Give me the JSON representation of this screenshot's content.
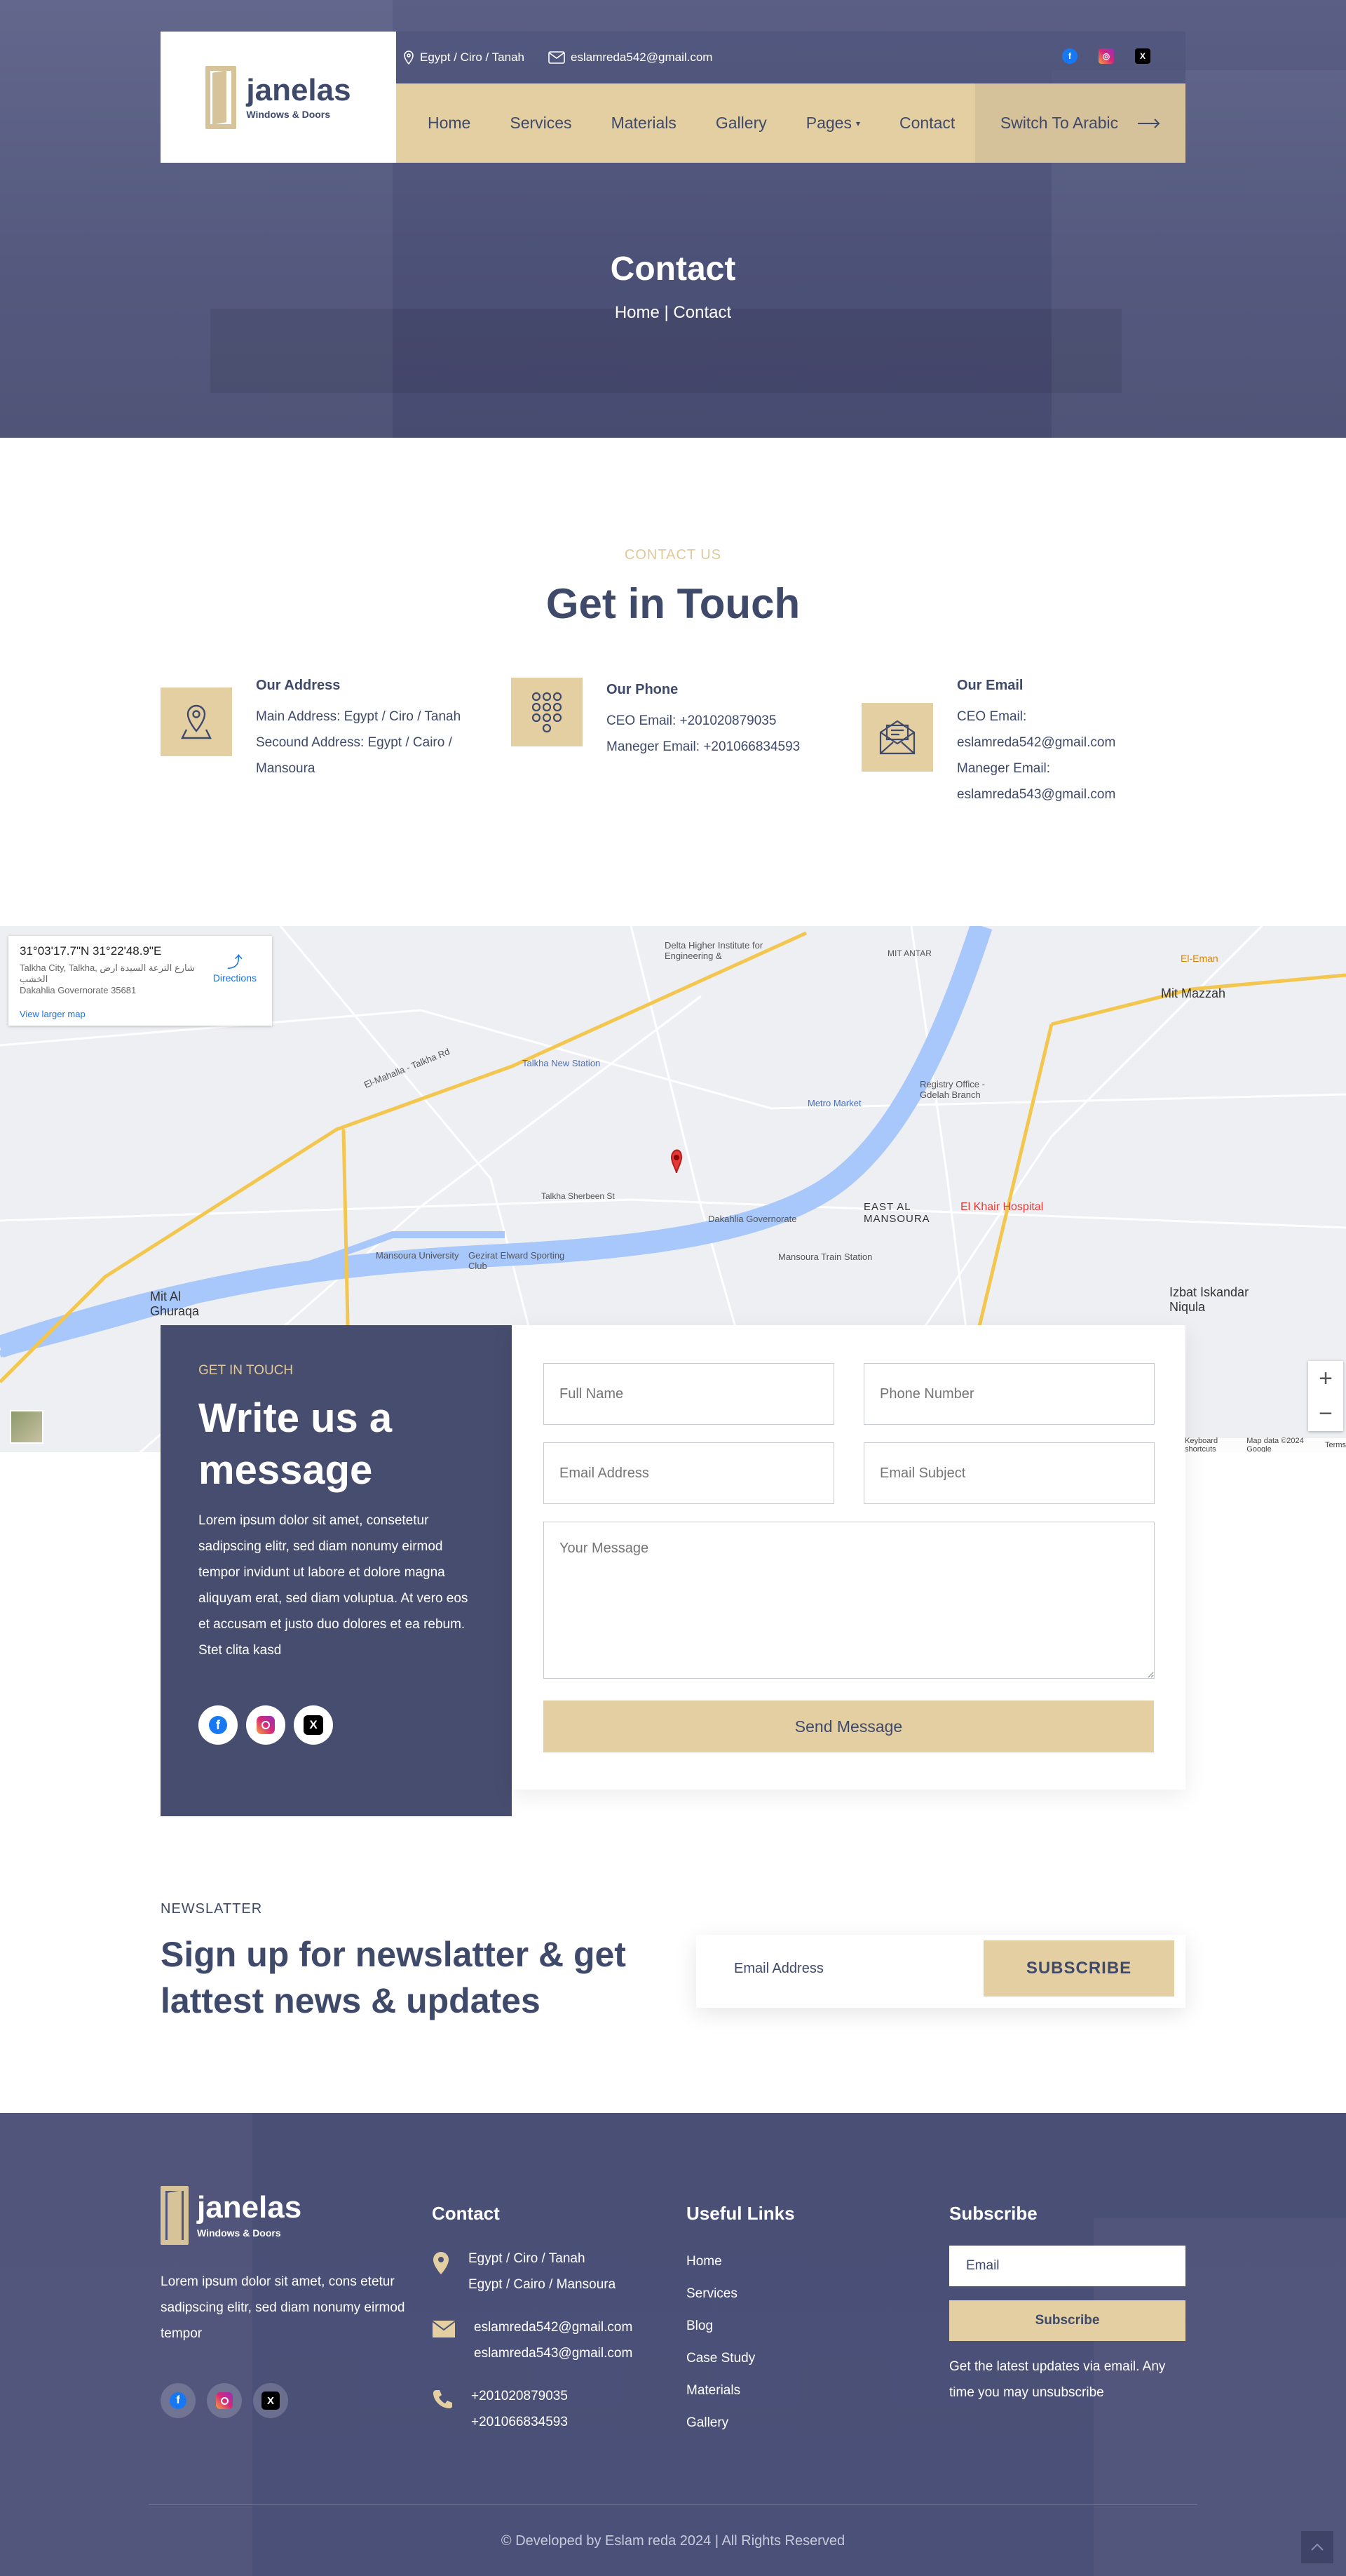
{
  "header": {
    "brand": "janelas",
    "tagline": "Windows & Doors",
    "address": "Egypt / Ciro / Tanah",
    "email": "eslamreda542@gmail.com",
    "nav": [
      "Home",
      "Services",
      "Materials",
      "Gallery",
      "Pages",
      "Contact"
    ],
    "switch_label": "Switch To Arabic"
  },
  "hero": {
    "title": "Contact",
    "breadcrumb": "Home | Contact"
  },
  "contact": {
    "eyebrow": "CONTACT US",
    "title": "Get in Touch",
    "address": {
      "heading": "Our Address",
      "lines": [
        "Main Address: Egypt / Ciro / Tanah",
        "Secound Address: Egypt / Cairo /",
        "Mansoura"
      ]
    },
    "phone": {
      "heading": "Our Phone",
      "lines": [
        "CEO Email: +201020879035",
        "Maneger Email: +201066834593"
      ]
    },
    "email": {
      "heading": "Our Email",
      "lines": [
        "CEO Email:",
        "eslamreda542@gmail.com",
        "Maneger Email:",
        "eslamreda543@gmail.com"
      ]
    }
  },
  "map": {
    "coords": "31°03'17.7\"N 31°22'48.9\"E",
    "address_line1": "Talkha City, Talkha, شارع الترعة السيدة ارض الخشب",
    "address_line2": "Dakahlia Governorate 35681",
    "directions": "Directions",
    "larger": "View larger map",
    "labels": [
      "El-Mahalla - Talkha Rd",
      "Talkha New Station",
      "Metro Market",
      "Registry Office - Gdelah Branch",
      "El Khair Hospital",
      "EAST AL MANSOURA",
      "Mansoura Train Station",
      "Mansoura University",
      "Gezirat Elward Sporting Club",
      "Dakahlia Governorate",
      "Mit Mazzah",
      "Izbat Iskandar Niqula",
      "Mit Al Ghuraqa",
      "El-Eman",
      "Delta Higher Institute for Engineering &",
      "MIT ANTAR",
      "Talkha Sherbeen St"
    ],
    "data_credit": "Map data ©2024 Google",
    "terms": "Terms",
    "shortcuts": "Keyboard shortcuts"
  },
  "message": {
    "eyebrow": "GET IN TOUCH",
    "title": "Write us a message",
    "body": "Lorem ipsum dolor sit amet, consetetur sadipscing elitr, sed diam nonumy eirmod tempor invidunt ut labore et dolore magna aliquyam erat, sed diam voluptua. At vero eos et accusam et justo duo dolores et ea rebum. Stet clita kasd"
  },
  "form": {
    "full_name": "Full Name",
    "phone": "Phone Number",
    "email": "Email Address",
    "subject": "Email Subject",
    "message": "Your Message",
    "send": "Send Message"
  },
  "newsletter": {
    "eyebrow": "NEWSLATTER",
    "title": "Sign up for newslatter & get lattest news & updates",
    "placeholder": "Email Address",
    "button": "SUBSCRIBE"
  },
  "footer": {
    "brand": "janelas",
    "tagline": "Windows & Doors",
    "about": "Lorem ipsum dolor sit amet, cons etetur sadipscing elitr, sed diam nonumy eirmod tempor",
    "contact_heading": "Contact",
    "addresses": [
      "Egypt / Ciro / Tanah",
      "Egypt / Cairo / Mansoura"
    ],
    "emails": [
      "eslamreda542@gmail.com",
      "eslamreda543@gmail.com"
    ],
    "phones": [
      "+201020879035",
      "+201066834593"
    ],
    "links_heading": "Useful Links",
    "links": [
      "Home",
      "Services",
      "Blog",
      "Case Study",
      "Materials",
      "Gallery"
    ],
    "subscribe_heading": "Subscribe",
    "email_placeholder": "Email",
    "subscribe_button": "Subscribe",
    "subscribe_note": "Get the latest updates via email. Any time you may unsubscribe",
    "copyright": "© Developed by Eslam reda  2024 | All Rights Reserved"
  },
  "colors": {
    "navy": "#464d6e",
    "gold": "#e4cfa3",
    "text": "#3f4a6a"
  }
}
